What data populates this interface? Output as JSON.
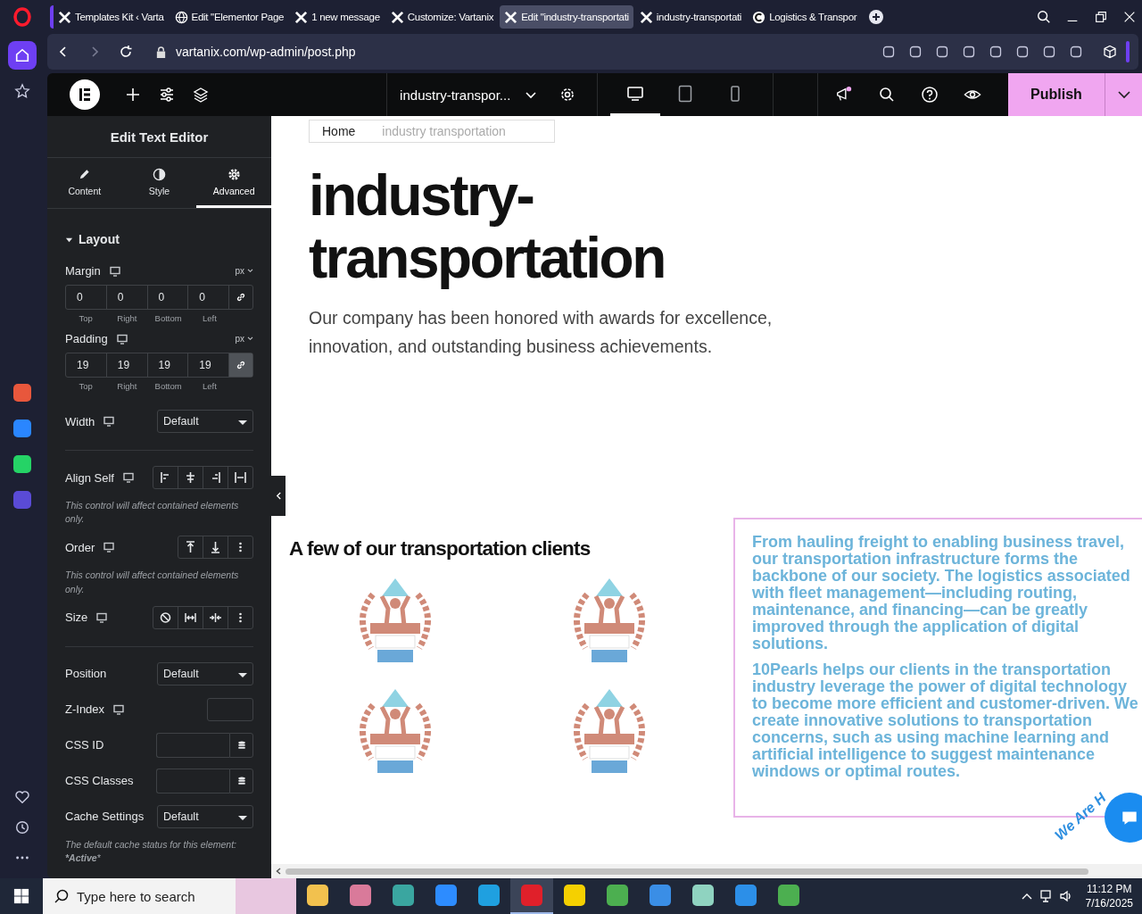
{
  "browser": {
    "tabs": [
      {
        "label": "Templates Kit ‹ Varta",
        "kind": "cross",
        "selected": false
      },
      {
        "label": "Edit \"Elementor Page",
        "kind": "globe",
        "selected": false
      },
      {
        "label": "1 new message",
        "kind": "cross",
        "selected": false
      },
      {
        "label": "Customize: Vartanix",
        "kind": "cross",
        "selected": false
      },
      {
        "label": "Edit \"industry-transportati",
        "kind": "cross",
        "selected": true
      },
      {
        "label": "industry-transportati",
        "kind": "cross",
        "selected": false
      },
      {
        "label": "Logistics & Transpor",
        "kind": "circle",
        "selected": false
      }
    ],
    "address": "vartanix.com/wp-admin/post.php"
  },
  "sidebar": {
    "items": [
      {
        "kind": "home",
        "selected": true
      },
      {
        "kind": "star",
        "selected": false
      },
      {
        "kind": "aria",
        "selected": false
      },
      {
        "kind": "messenger",
        "selected": false
      },
      {
        "kind": "whatsapp",
        "selected": false
      },
      {
        "kind": "music",
        "selected": false
      }
    ]
  },
  "topbar": {
    "page_name": "industry-transpor...",
    "devices": [
      {
        "kind": "desktop",
        "selected": true
      },
      {
        "kind": "tablet",
        "selected": false
      },
      {
        "kind": "mobile",
        "selected": false
      }
    ],
    "publish": "Publish"
  },
  "panel": {
    "title": "Edit Text Editor",
    "tabs": [
      {
        "label": "Content",
        "kind": "pencil",
        "selected": false
      },
      {
        "label": "Style",
        "kind": "contrast",
        "selected": false
      },
      {
        "label": "Advanced",
        "kind": "gear",
        "selected": true
      }
    ],
    "section": {
      "title": "Layout",
      "expanded": true
    },
    "margin": {
      "label": "Margin",
      "unit": "px",
      "values": [
        "0",
        "0",
        "0",
        "0"
      ],
      "sides": [
        "Top",
        "Right",
        "Bottom",
        "Left"
      ],
      "linked": false
    },
    "padding": {
      "label": "Padding",
      "unit": "px",
      "values": [
        "19",
        "19",
        "19",
        "19"
      ],
      "sides": [
        "Top",
        "Right",
        "Bottom",
        "Left"
      ],
      "linked": true
    },
    "width": {
      "label": "Width",
      "value": "Default"
    },
    "align_self": {
      "label": "Align Self",
      "note": "This control will affect contained elements only."
    },
    "order": {
      "label": "Order",
      "note": "This control will affect contained elements only."
    },
    "size": {
      "label": "Size"
    },
    "position": {
      "label": "Position",
      "value": "Default"
    },
    "z_index": {
      "label": "Z-Index"
    },
    "css_id": {
      "label": "CSS ID"
    },
    "css_classes": {
      "label": "CSS Classes"
    },
    "cache": {
      "label": "Cache Settings",
      "value": "Default",
      "note": "The default cache status for this element: ***Active***"
    }
  },
  "canvas": {
    "breadcrumb": [
      "Home",
      "industry transportation"
    ],
    "heading": "industry-transportation",
    "intro": "Our company has been honored with awards for excellence, innovation, and outstanding business achievements.",
    "clients_heading": "A few of our transportation clients",
    "awards": [
      {
        "kind": "badge"
      },
      {
        "kind": "badge"
      },
      {
        "kind": "badge"
      },
      {
        "kind": "badge"
      }
    ],
    "paragraphs": [
      "From hauling freight to enabling business travel, our transportation infrastructure forms the backbone of our society. The logistics associated with fleet management—including routing, maintenance, and financing—can be greatly improved through the application of digital solutions.",
      "10Pearls helps our clients in the transportation industry leverage the power of digital technology to become more efficient and customer-driven. We create innovative solutions to transportation concerns, such as using machine learning and artificial intelligence to suggest maintenance windows or optimal routes."
    ],
    "chat_badge": "We Are H"
  },
  "taskbar": {
    "search_placeholder": "Type here to search",
    "apps": [
      {
        "kind": "folder",
        "selected": false
      },
      {
        "kind": "paint",
        "selected": false
      },
      {
        "kind": "gem",
        "selected": false
      },
      {
        "kind": "zoom",
        "selected": false
      },
      {
        "kind": "edge",
        "selected": false
      },
      {
        "kind": "opera",
        "selected": true
      },
      {
        "kind": "notes",
        "selected": false
      },
      {
        "kind": "chrome",
        "selected": false
      },
      {
        "kind": "photos",
        "selected": false
      },
      {
        "kind": "glass",
        "selected": false
      },
      {
        "kind": "vscode",
        "selected": false
      },
      {
        "kind": "chrome",
        "selected": false
      }
    ],
    "time": "11:12 PM",
    "date": "7/16/2025"
  }
}
